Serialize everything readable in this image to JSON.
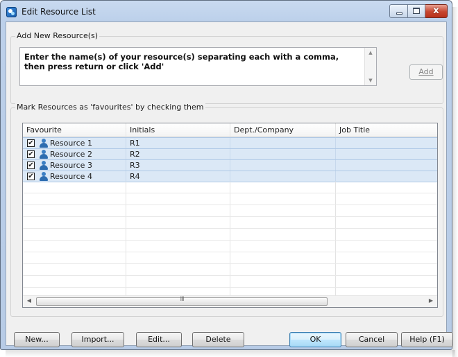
{
  "window": {
    "title": "Edit Resource List",
    "app_icon": "resource-app-icon",
    "close_glyph": "x"
  },
  "add_group": {
    "label": "Add New Resource(s)",
    "input_text": "Enter the name(s) of your resource(s) separating each with a comma, then press return or click 'Add'",
    "add_button": "Add"
  },
  "list_group": {
    "label": "Mark Resources as 'favourites' by checking them",
    "columns": [
      "Favourite",
      "Initials",
      "Dept./Company",
      "Job Title"
    ],
    "rows": [
      {
        "name": "Resource 1",
        "initials": "R1",
        "dept": "",
        "job_title": "",
        "favourite": true
      },
      {
        "name": "Resource 2",
        "initials": "R2",
        "dept": "",
        "job_title": "",
        "favourite": true
      },
      {
        "name": "Resource 3",
        "initials": "R3",
        "dept": "",
        "job_title": "",
        "favourite": true
      },
      {
        "name": "Resource 4",
        "initials": "R4",
        "dept": "",
        "job_title": "",
        "favourite": true
      }
    ],
    "check_glyph": "✔",
    "scroll_grip": "III"
  },
  "buttons": {
    "new": "New...",
    "import": "Import...",
    "edit": "Edit...",
    "delete": "Delete",
    "ok": "OK",
    "cancel": "Cancel",
    "help": "Help (F1)"
  },
  "colors": {
    "row_selected": "#dbe8f6",
    "person_icon": "#2c6cb0",
    "close_button": "#c7462f"
  }
}
